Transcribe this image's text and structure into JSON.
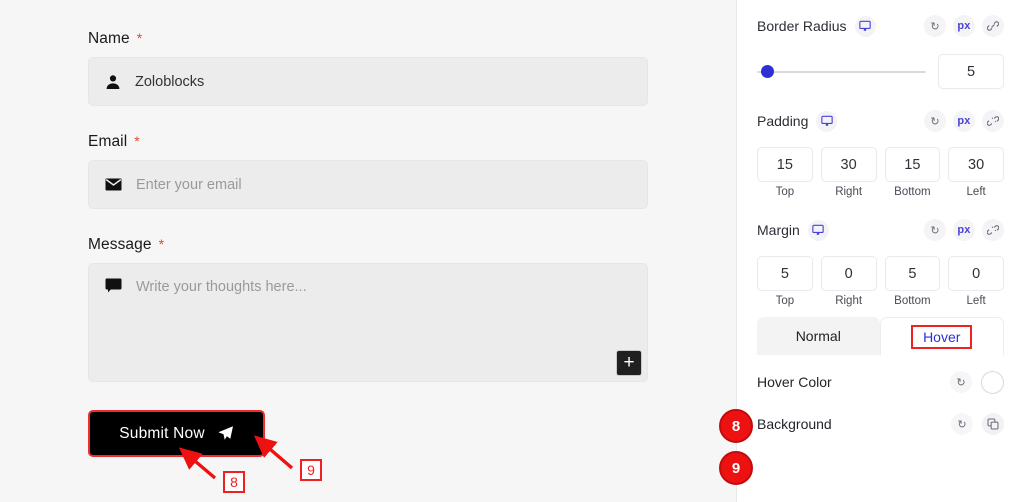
{
  "canvas": {
    "form": {
      "fields": [
        {
          "label": "Name",
          "required_mark": "*",
          "icon": "user-icon",
          "value": "Zoloblocks",
          "placeholder": ""
        },
        {
          "label": "Email",
          "required_mark": "*",
          "icon": "envelope-icon",
          "value": "",
          "placeholder": "Enter your email"
        },
        {
          "label": "Message",
          "required_mark": "*",
          "icon": "comment-icon",
          "value": "",
          "placeholder": "Write your thoughts here..."
        }
      ],
      "add_button_glyph": "+",
      "submit_label": "Submit Now"
    },
    "annotations": [
      {
        "id": "8",
        "label": "8"
      },
      {
        "id": "9",
        "label": "9"
      }
    ]
  },
  "panel": {
    "border_radius": {
      "title": "Border Radius",
      "device_icon": "desktop-icon",
      "reset_icon": "reset-icon",
      "unit": "px",
      "link_icon": "link-icon",
      "value": "5",
      "slider_percent": 3
    },
    "padding": {
      "title": "Padding",
      "device_icon": "desktop-icon",
      "reset_icon": "reset-icon",
      "unit": "px",
      "link_icon": "link-broken-icon",
      "sides": [
        {
          "value": "15",
          "label": "Top"
        },
        {
          "value": "30",
          "label": "Right"
        },
        {
          "value": "15",
          "label": "Bottom"
        },
        {
          "value": "30",
          "label": "Left"
        }
      ]
    },
    "margin": {
      "title": "Margin",
      "device_icon": "desktop-icon",
      "reset_icon": "reset-icon",
      "unit": "px",
      "link_icon": "link-broken-icon",
      "sides": [
        {
          "value": "5",
          "label": "Top"
        },
        {
          "value": "0",
          "label": "Right"
        },
        {
          "value": "5",
          "label": "Bottom"
        },
        {
          "value": "0",
          "label": "Left"
        }
      ]
    },
    "tabs": [
      {
        "label": "Normal",
        "active": false
      },
      {
        "label": "Hover",
        "active": true
      }
    ],
    "rows": [
      {
        "label": "Hover Color",
        "marker": "8",
        "reset_icon": "reset-icon",
        "control_icon": "color-swatch-icon",
        "swatch_color": "#ffffff"
      },
      {
        "label": "Background",
        "marker": "9",
        "reset_icon": "reset-icon",
        "control_icon": "copy-layers-icon"
      }
    ]
  },
  "colors": {
    "accent_indigo": "#4a42d6",
    "marker_red": "#ee1111",
    "canvas_bg": "#f6f6f6",
    "input_bg": "#ececec",
    "submit_bg": "#000000"
  }
}
